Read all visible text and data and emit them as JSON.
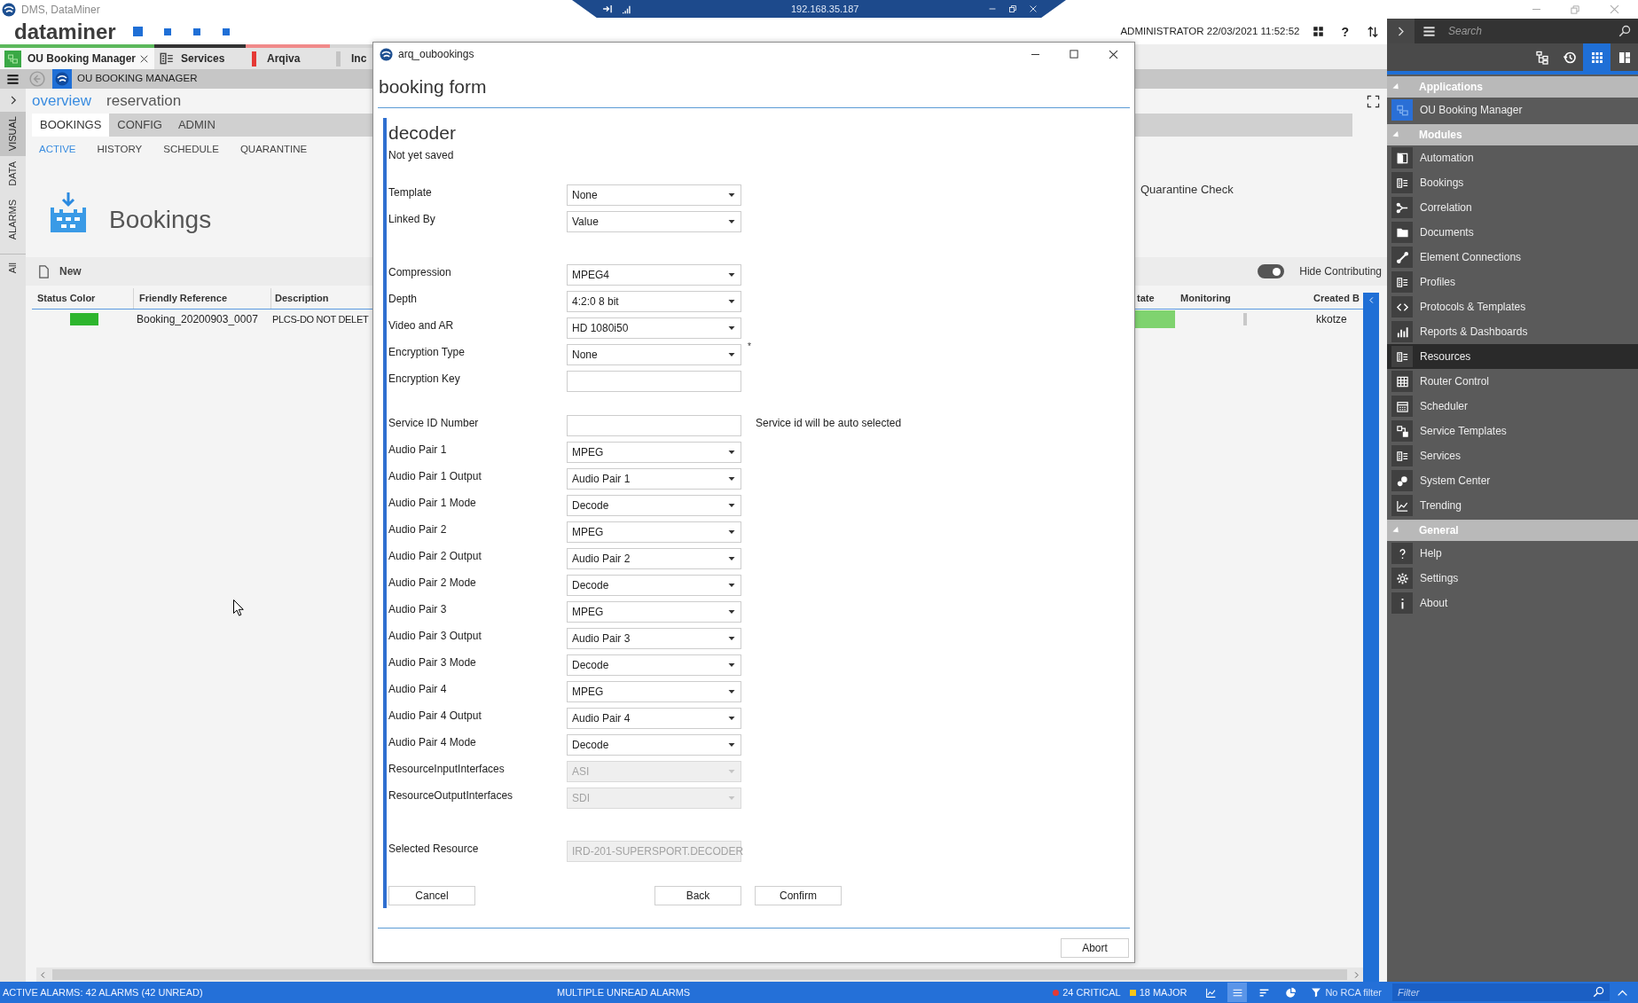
{
  "window": {
    "title": "DMS, DataMiner"
  },
  "remote_bar": {
    "address": "192.168.35.187"
  },
  "header": {
    "logo": "dataminer",
    "user_and_time": "ADMINISTRATOR 22/03/2021 11:52:52",
    "help": "?"
  },
  "app_tabs": [
    {
      "label": "OU Booking Manager",
      "selected": true,
      "closable": true,
      "color": "#5cb85c"
    },
    {
      "label": "Services",
      "selected": false,
      "closable": false,
      "color": "#333333"
    },
    {
      "label": "Arqiva",
      "selected": false,
      "closable": false,
      "color": "#f08a8a",
      "marker": {
        "color": "#e53935"
      }
    },
    {
      "label": "Inc",
      "selected": false,
      "closable": false,
      "color": "#d6d6d6",
      "marker": {
        "color": "#c4c4c4"
      }
    }
  ],
  "breadcrumb": {
    "title": "OU BOOKING MANAGER"
  },
  "side_rail": [
    {
      "label": "VISUAL",
      "selected": true
    },
    {
      "label": "DATA",
      "selected": false
    },
    {
      "label": "ALARMS",
      "selected": false
    },
    {
      "label": "All",
      "selected": false
    }
  ],
  "page_tabs": [
    {
      "label": "overview",
      "selected": true
    },
    {
      "label": "reservation",
      "selected": false
    }
  ],
  "section_tabs": [
    {
      "label": "BOOKINGS",
      "selected": true
    },
    {
      "label": "CONFIG",
      "selected": false
    },
    {
      "label": "ADMIN",
      "selected": false
    }
  ],
  "sub_tabs": [
    {
      "label": "ACTIVE",
      "selected": true
    },
    {
      "label": "HISTORY",
      "selected": false
    },
    {
      "label": "SCHEDULE",
      "selected": false
    },
    {
      "label": "QUARANTINE",
      "selected": false
    }
  ],
  "bookings_panel": {
    "heading": "Bookings",
    "quarantine_check": "Quarantine Check",
    "new_button": "New",
    "hide_contributing": {
      "label": "Hide Contributing",
      "on": true
    },
    "table": {
      "columns": [
        "Status Color",
        "Friendly Reference",
        "Description",
        "tate",
        "Monitoring",
        "Created B"
      ],
      "rows": [
        {
          "status": {
            "color": "#2db52d"
          },
          "friendly_reference": "Booking_20200903_0007",
          "description": "PLCS-DO NOT DELET",
          "column_4": {
            "color": "#7fd36f"
          },
          "column_6": "kkotze"
        }
      ]
    }
  },
  "dialog": {
    "title": "arq_oubookings",
    "heading": "booking form",
    "form": {
      "title": "decoder",
      "status": "Not yet saved",
      "groups": [
        [
          {
            "label": "Template",
            "kind": "dropdown",
            "value": "None",
            "disabled": false
          },
          {
            "label": "Linked By",
            "kind": "dropdown",
            "value": "Value",
            "disabled": false
          }
        ],
        [
          {
            "label": "Compression",
            "kind": "dropdown",
            "value": "MPEG4",
            "disabled": false
          },
          {
            "label": "Depth",
            "kind": "dropdown",
            "value": "4:2:0 8 bit",
            "disabled": false
          },
          {
            "label": "Video and AR",
            "kind": "dropdown",
            "value": "HD 1080i50",
            "disabled": false
          },
          {
            "label": "Encryption Type",
            "kind": "dropdown",
            "value": "None",
            "disabled": false,
            "required_mark": "*"
          },
          {
            "label": "Encryption Key",
            "kind": "text",
            "disabled": false
          }
        ],
        [
          {
            "label": "Service ID Number",
            "kind": "text",
            "disabled": false,
            "hint": "Service id will be auto selected"
          },
          {
            "label": "Audio Pair 1",
            "kind": "dropdown",
            "value": "MPEG",
            "disabled": false
          },
          {
            "label": "Audio Pair 1 Output",
            "kind": "dropdown",
            "value": "Audio Pair 1",
            "disabled": false
          },
          {
            "label": "Audio Pair 1 Mode",
            "kind": "dropdown",
            "value": "Decode",
            "disabled": false
          },
          {
            "label": "Audio Pair 2",
            "kind": "dropdown",
            "value": "MPEG",
            "disabled": false
          },
          {
            "label": "Audio Pair 2 Output",
            "kind": "dropdown",
            "value": "Audio Pair 2",
            "disabled": false
          },
          {
            "label": "Audio Pair 2 Mode",
            "kind": "dropdown",
            "value": "Decode",
            "disabled": false
          },
          {
            "label": "Audio Pair 3",
            "kind": "dropdown",
            "value": "MPEG",
            "disabled": false
          },
          {
            "label": "Audio Pair 3 Output",
            "kind": "dropdown",
            "value": "Audio Pair 3",
            "disabled": false
          },
          {
            "label": "Audio Pair 3 Mode",
            "kind": "dropdown",
            "value": "Decode",
            "disabled": false
          },
          {
            "label": "Audio Pair 4",
            "kind": "dropdown",
            "value": "MPEG",
            "disabled": false
          },
          {
            "label": "Audio Pair 4 Output",
            "kind": "dropdown",
            "value": "Audio Pair 4",
            "disabled": false
          },
          {
            "label": "Audio Pair 4 Mode",
            "kind": "dropdown",
            "value": "Decode",
            "disabled": false
          },
          {
            "label": "ResourceInputInterfaces",
            "kind": "dropdown",
            "value": "ASI",
            "disabled": true
          },
          {
            "label": "ResourceOutputInterfaces",
            "kind": "dropdown",
            "value": "SDI",
            "disabled": true
          }
        ],
        [
          {
            "label": "Selected Resource",
            "kind": "dropdown",
            "value": "IRD-201-SUPERSPORT.DECODER",
            "disabled": true
          }
        ]
      ]
    },
    "actions": [
      {
        "label": "Cancel"
      },
      {
        "label": "Back"
      },
      {
        "label": "Confirm"
      }
    ],
    "footer_button": "Abort"
  },
  "side_panel": {
    "search": {
      "placeholder": "Search"
    },
    "view_buttons": [
      {
        "selected": false
      },
      {
        "selected": false
      },
      {
        "selected": true
      },
      {
        "selected": false
      }
    ],
    "sections": [
      {
        "title": "Applications",
        "expanded": true,
        "items": [
          {
            "label": "OU Booking Manager",
            "selected": false
          }
        ]
      },
      {
        "title": "Modules",
        "expanded": true,
        "items": [
          {
            "label": "Automation",
            "selected": false
          },
          {
            "label": "Bookings",
            "selected": false
          },
          {
            "label": "Correlation",
            "selected": false
          },
          {
            "label": "Documents",
            "selected": false
          },
          {
            "label": "Element Connections",
            "selected": false
          },
          {
            "label": "Profiles",
            "selected": false
          },
          {
            "label": "Protocols & Templates",
            "selected": false
          },
          {
            "label": "Reports & Dashboards",
            "selected": false
          },
          {
            "label": "Resources",
            "selected": true
          },
          {
            "label": "Router Control",
            "selected": false
          },
          {
            "label": "Scheduler",
            "selected": false
          },
          {
            "label": "Service Templates",
            "selected": false
          },
          {
            "label": "Services",
            "selected": false
          },
          {
            "label": "System Center",
            "selected": false
          },
          {
            "label": "Trending",
            "selected": false
          }
        ]
      },
      {
        "title": "General",
        "expanded": true,
        "items": [
          {
            "label": "Help",
            "selected": false
          },
          {
            "label": "Settings",
            "selected": false
          },
          {
            "label": "About",
            "selected": false
          }
        ]
      }
    ]
  },
  "status_bar": {
    "active_alarms": "ACTIVE ALARMS: 42 ALARMS (42 UNREAD)",
    "message": "MULTIPLE UNREAD ALARMS",
    "counters": [
      {
        "label": "24 CRITICAL",
        "kind": "critical",
        "color": "#e53935"
      },
      {
        "label": "18 MAJOR",
        "kind": "major",
        "color": "#f5c518"
      }
    ],
    "tools": [
      {
        "selected": false
      },
      {
        "selected": true
      },
      {
        "selected": false
      },
      {
        "selected": false
      }
    ],
    "rca_filter": "No RCA filter",
    "filter": {
      "placeholder": "Filter"
    }
  }
}
